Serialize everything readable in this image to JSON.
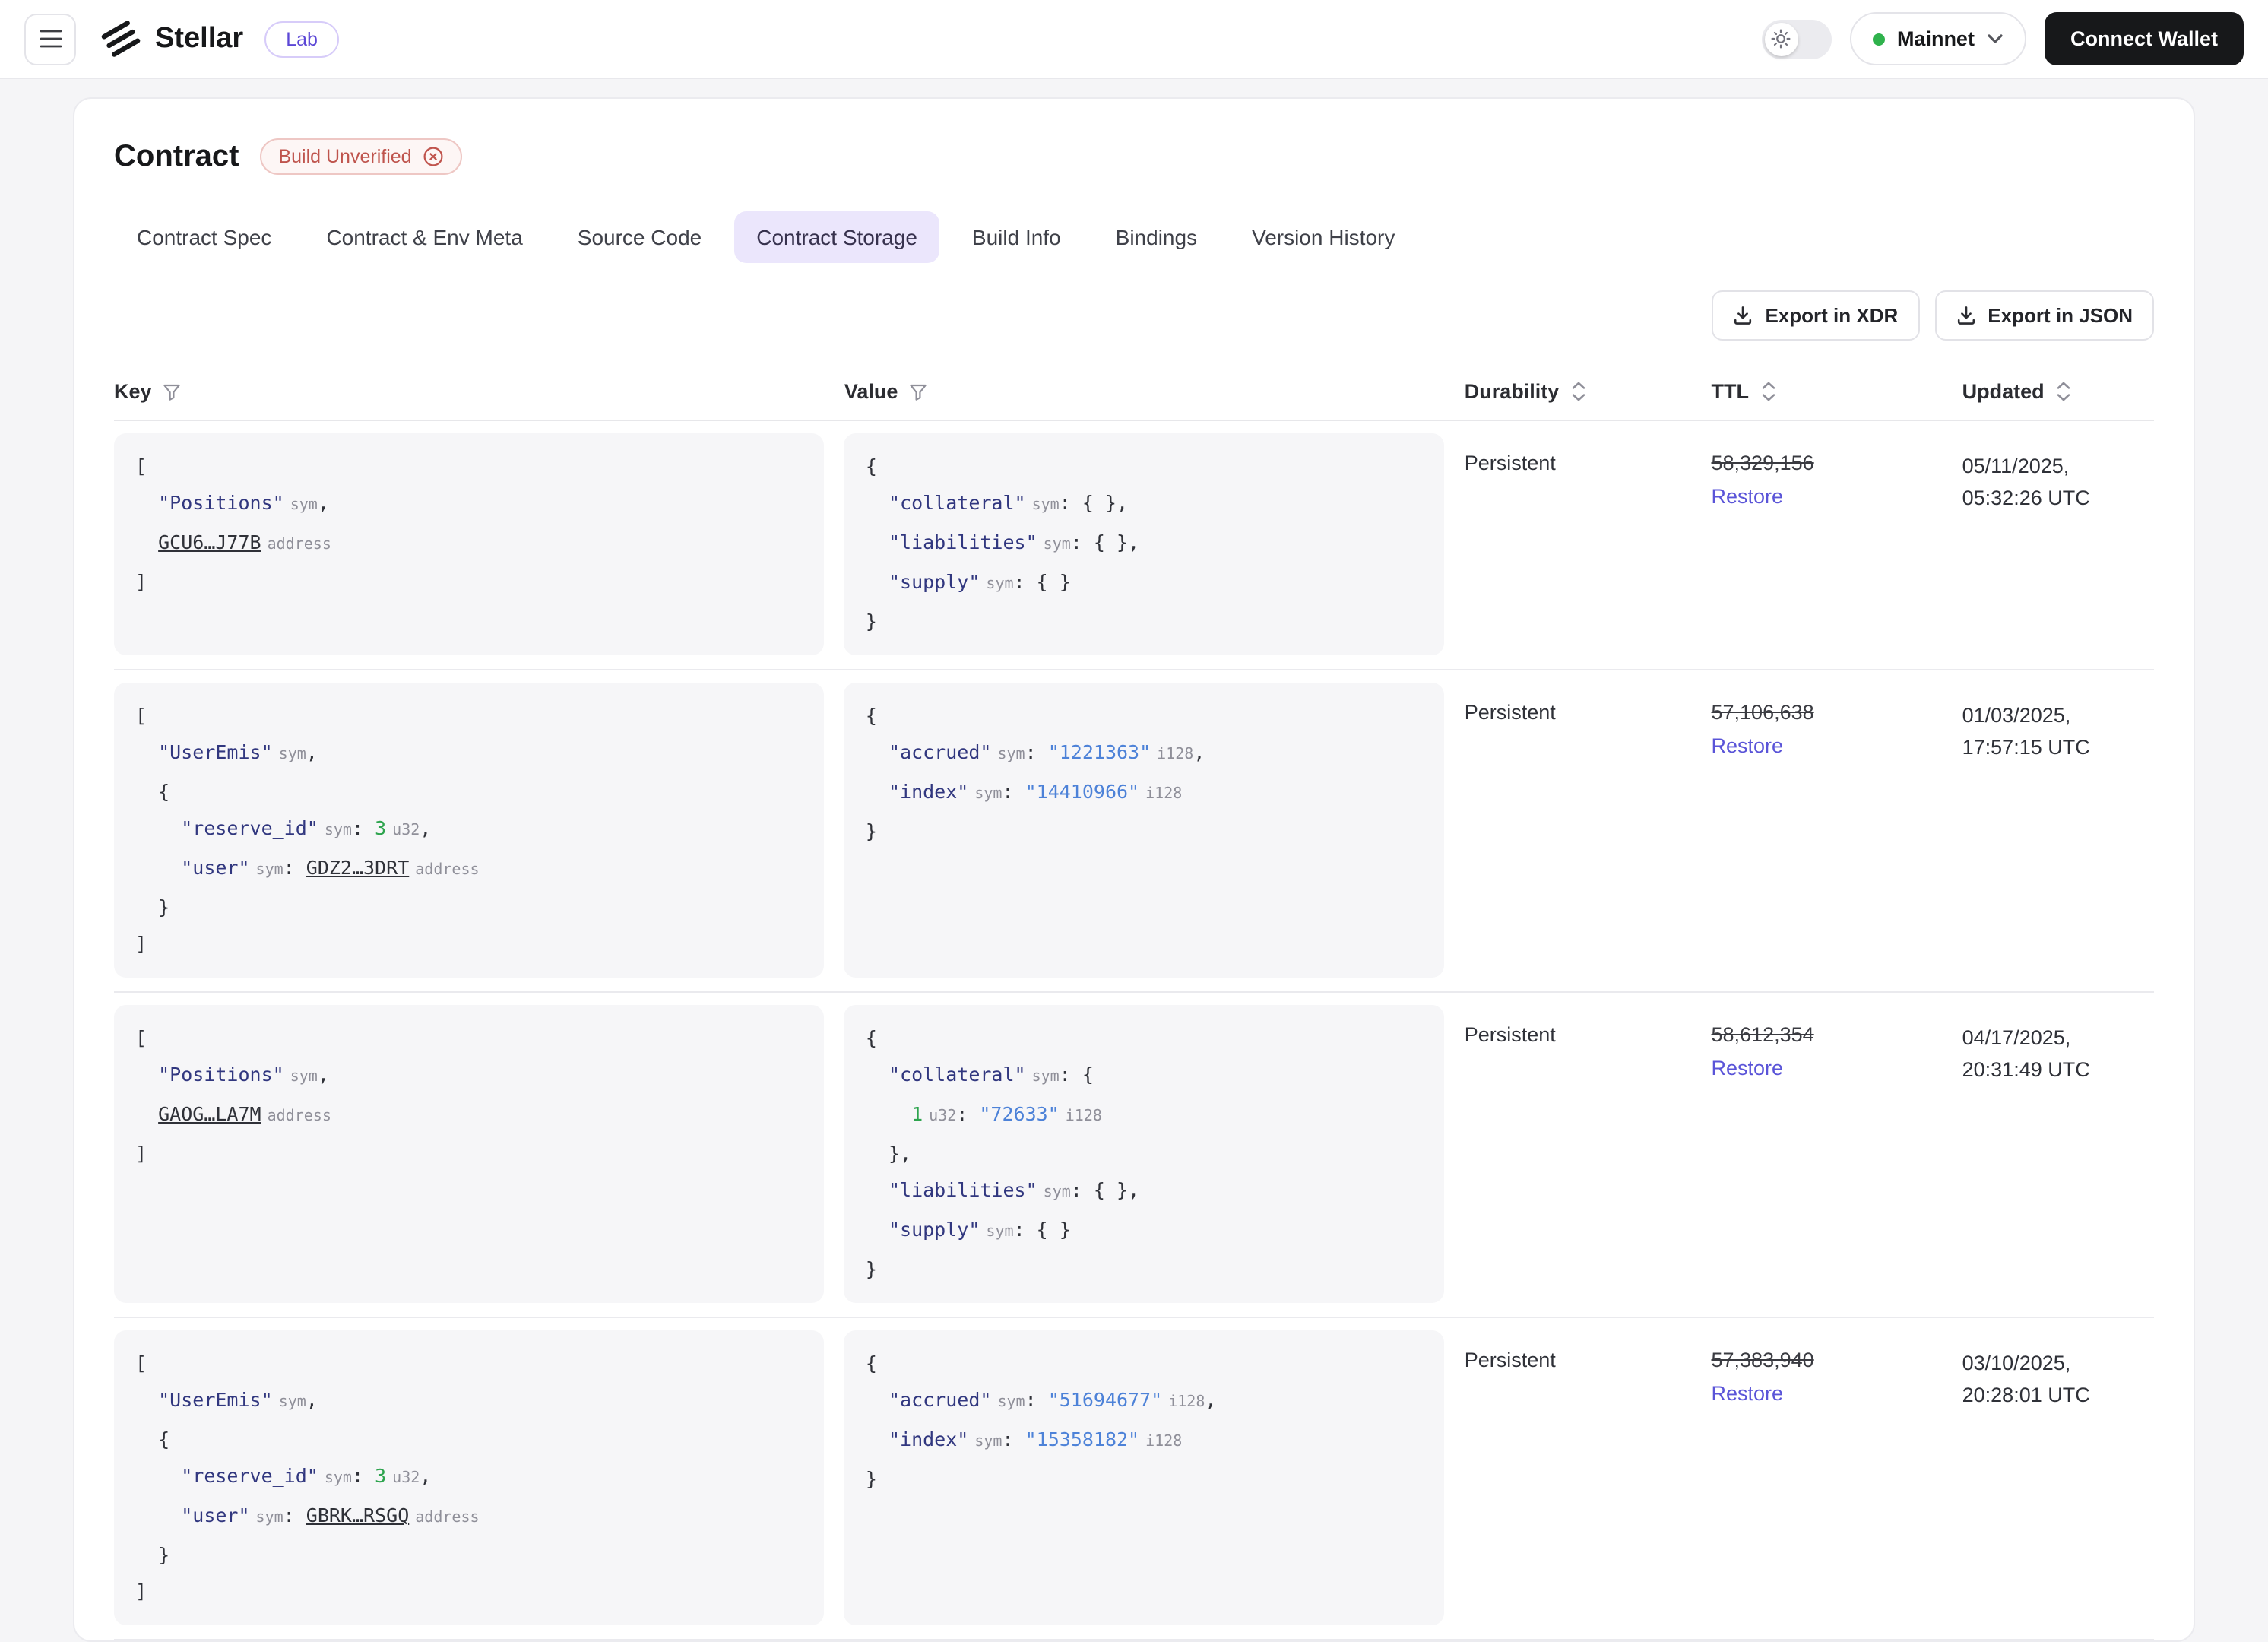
{
  "header": {
    "app_name": "Stellar",
    "badge": "Lab",
    "network": "Mainnet",
    "connect_wallet": "Connect Wallet",
    "network_dot_color": "#2fb24c"
  },
  "icons": {
    "menu": "hamburger",
    "theme": "sun",
    "network_caret": "chevron-down",
    "export": "download-tray",
    "filter": "funnel",
    "sort": "up-down-chevrons",
    "build_badge": "x-circle"
  },
  "page": {
    "title": "Contract",
    "build_badge": "Build Unverified",
    "tabs": [
      {
        "label": "Contract Spec",
        "active": false
      },
      {
        "label": "Contract & Env Meta",
        "active": false
      },
      {
        "label": "Source Code",
        "active": false
      },
      {
        "label": "Contract Storage",
        "active": true
      },
      {
        "label": "Build Info",
        "active": false
      },
      {
        "label": "Bindings",
        "active": false
      },
      {
        "label": "Version History",
        "active": false
      }
    ],
    "export_buttons": [
      "Export in XDR",
      "Export in JSON"
    ],
    "active_tab_bg": "#ebe6fc",
    "accent_red": "#bf544d",
    "restore_color": "#5a54d8"
  },
  "table": {
    "columns": [
      {
        "label": "Key",
        "icon": "filter"
      },
      {
        "label": "Value",
        "icon": "filter"
      },
      {
        "label": "Durability",
        "icon": "sort"
      },
      {
        "label": "TTL",
        "icon": "sort"
      },
      {
        "label": "Updated",
        "icon": "sort"
      }
    ],
    "restore_label": "Restore",
    "rows": [
      {
        "key": [
          [
            [
              "p",
              "["
            ]
          ],
          [
            [
              "p",
              "  "
            ],
            [
              "k",
              "\"Positions\""
            ],
            [
              "t",
              "sym"
            ],
            [
              "p",
              ","
            ]
          ],
          [
            [
              "p",
              "  "
            ],
            [
              "a",
              "GCU6…J77B"
            ],
            [
              "t",
              "address"
            ]
          ],
          [
            [
              "p",
              "]"
            ]
          ]
        ],
        "value": [
          [
            [
              "p",
              "{"
            ]
          ],
          [
            [
              "p",
              "  "
            ],
            [
              "k",
              "\"collateral\""
            ],
            [
              "t",
              "sym"
            ],
            [
              "p",
              ": { },"
            ]
          ],
          [
            [
              "p",
              "  "
            ],
            [
              "k",
              "\"liabilities\""
            ],
            [
              "t",
              "sym"
            ],
            [
              "p",
              ": { },"
            ]
          ],
          [
            [
              "p",
              "  "
            ],
            [
              "k",
              "\"supply\""
            ],
            [
              "t",
              "sym"
            ],
            [
              "p",
              ": { }"
            ]
          ],
          [
            [
              "p",
              "}"
            ]
          ]
        ],
        "durability": "Persistent",
        "ttl": "58,329,156",
        "updated_date": "05/11/2025,",
        "updated_time": "05:32:26 UTC"
      },
      {
        "key": [
          [
            [
              "p",
              "["
            ]
          ],
          [
            [
              "p",
              "  "
            ],
            [
              "k",
              "\"UserEmis\""
            ],
            [
              "t",
              "sym"
            ],
            [
              "p",
              ","
            ]
          ],
          [
            [
              "p",
              "  {"
            ]
          ],
          [
            [
              "p",
              "    "
            ],
            [
              "k",
              "\"reserve_id\""
            ],
            [
              "t",
              "sym"
            ],
            [
              "p",
              ": "
            ],
            [
              "n",
              "3"
            ],
            [
              "t",
              "u32"
            ],
            [
              "p",
              ","
            ]
          ],
          [
            [
              "p",
              "    "
            ],
            [
              "k",
              "\"user\""
            ],
            [
              "t",
              "sym"
            ],
            [
              "p",
              ": "
            ],
            [
              "a",
              "GDZ2…3DRT"
            ],
            [
              "t",
              "address"
            ]
          ],
          [
            [
              "p",
              "  }"
            ]
          ],
          [
            [
              "p",
              "]"
            ]
          ]
        ],
        "value": [
          [
            [
              "p",
              "{"
            ]
          ],
          [
            [
              "p",
              "  "
            ],
            [
              "k",
              "\"accrued\""
            ],
            [
              "t",
              "sym"
            ],
            [
              "p",
              ": "
            ],
            [
              "s",
              "\"1221363\""
            ],
            [
              "t",
              "i128"
            ],
            [
              "p",
              ","
            ]
          ],
          [
            [
              "p",
              "  "
            ],
            [
              "k",
              "\"index\""
            ],
            [
              "t",
              "sym"
            ],
            [
              "p",
              ": "
            ],
            [
              "s",
              "\"14410966\""
            ],
            [
              "t",
              "i128"
            ]
          ],
          [
            [
              "p",
              "}"
            ]
          ]
        ],
        "durability": "Persistent",
        "ttl": "57,106,638",
        "updated_date": "01/03/2025,",
        "updated_time": "17:57:15 UTC"
      },
      {
        "key": [
          [
            [
              "p",
              "["
            ]
          ],
          [
            [
              "p",
              "  "
            ],
            [
              "k",
              "\"Positions\""
            ],
            [
              "t",
              "sym"
            ],
            [
              "p",
              ","
            ]
          ],
          [
            [
              "p",
              "  "
            ],
            [
              "a",
              "GAOG…LA7M"
            ],
            [
              "t",
              "address"
            ]
          ],
          [
            [
              "p",
              "]"
            ]
          ]
        ],
        "value": [
          [
            [
              "p",
              "{"
            ]
          ],
          [
            [
              "p",
              "  "
            ],
            [
              "k",
              "\"collateral\""
            ],
            [
              "t",
              "sym"
            ],
            [
              "p",
              ": {"
            ]
          ],
          [
            [
              "p",
              "    "
            ],
            [
              "n",
              "1"
            ],
            [
              "t",
              "u32"
            ],
            [
              "p",
              ": "
            ],
            [
              "s",
              "\"72633\""
            ],
            [
              "t",
              "i128"
            ]
          ],
          [
            [
              "p",
              "  },"
            ]
          ],
          [
            [
              "p",
              "  "
            ],
            [
              "k",
              "\"liabilities\""
            ],
            [
              "t",
              "sym"
            ],
            [
              "p",
              ": { },"
            ]
          ],
          [
            [
              "p",
              "  "
            ],
            [
              "k",
              "\"supply\""
            ],
            [
              "t",
              "sym"
            ],
            [
              "p",
              ": { }"
            ]
          ],
          [
            [
              "p",
              "}"
            ]
          ]
        ],
        "durability": "Persistent",
        "ttl": "58,612,354",
        "updated_date": "04/17/2025,",
        "updated_time": "20:31:49 UTC"
      },
      {
        "key": [
          [
            [
              "p",
              "["
            ]
          ],
          [
            [
              "p",
              "  "
            ],
            [
              "k",
              "\"UserEmis\""
            ],
            [
              "t",
              "sym"
            ],
            [
              "p",
              ","
            ]
          ],
          [
            [
              "p",
              "  {"
            ]
          ],
          [
            [
              "p",
              "    "
            ],
            [
              "k",
              "\"reserve_id\""
            ],
            [
              "t",
              "sym"
            ],
            [
              "p",
              ": "
            ],
            [
              "n",
              "3"
            ],
            [
              "t",
              "u32"
            ],
            [
              "p",
              ","
            ]
          ],
          [
            [
              "p",
              "    "
            ],
            [
              "k",
              "\"user\""
            ],
            [
              "t",
              "sym"
            ],
            [
              "p",
              ": "
            ],
            [
              "a",
              "GBRK…RSGQ"
            ],
            [
              "t",
              "address"
            ]
          ],
          [
            [
              "p",
              "  }"
            ]
          ],
          [
            [
              "p",
              "]"
            ]
          ]
        ],
        "value": [
          [
            [
              "p",
              "{"
            ]
          ],
          [
            [
              "p",
              "  "
            ],
            [
              "k",
              "\"accrued\""
            ],
            [
              "t",
              "sym"
            ],
            [
              "p",
              ": "
            ],
            [
              "s",
              "\"51694677\""
            ],
            [
              "t",
              "i128"
            ],
            [
              "p",
              ","
            ]
          ],
          [
            [
              "p",
              "  "
            ],
            [
              "k",
              "\"index\""
            ],
            [
              "t",
              "sym"
            ],
            [
              "p",
              ": "
            ],
            [
              "s",
              "\"15358182\""
            ],
            [
              "t",
              "i128"
            ]
          ],
          [
            [
              "p",
              "}"
            ]
          ]
        ],
        "durability": "Persistent",
        "ttl": "57,383,940",
        "updated_date": "03/10/2025,",
        "updated_time": "20:28:01 UTC"
      }
    ]
  }
}
